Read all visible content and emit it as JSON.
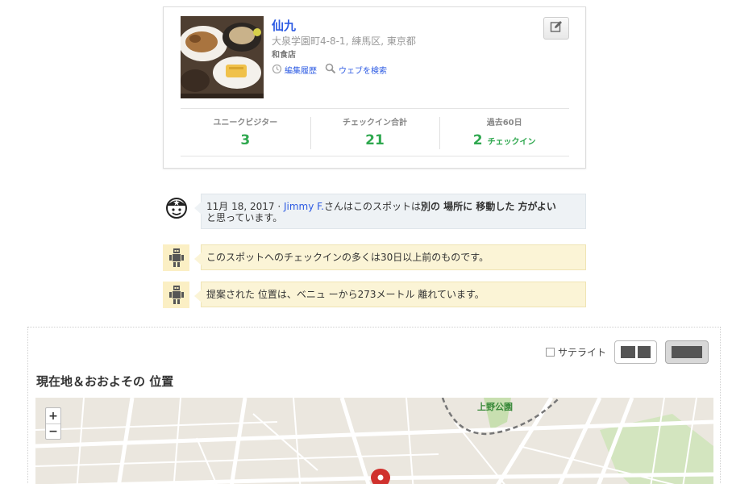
{
  "venue": {
    "name": "仙九",
    "address": "大泉学園町4-8-1, 練馬区, 東京都",
    "category": "和食店",
    "links": [
      {
        "label": "編集履歴",
        "icon": "history-icon"
      },
      {
        "label": "ウェブを検索",
        "icon": "search-icon"
      }
    ],
    "edit_icon": "edit-icon"
  },
  "stats": [
    {
      "label": "ユニークビジター",
      "value": "3",
      "suffix": ""
    },
    {
      "label": "チェックイン合計",
      "value": "21",
      "suffix": ""
    },
    {
      "label": "過去60日",
      "value": "2",
      "suffix": "チェックイン"
    }
  ],
  "flags": [
    {
      "date": "11月 18, 2017 ·",
      "user": "Jimmy F.",
      "text_pre": "さんはこのスポットは",
      "text_strong": "別の 場所に 移動した 方がよい",
      "text_post": "と思っています。"
    },
    {
      "text": "このスポットへのチェックインの多くは30日以上前のものです。"
    },
    {
      "text": "提案された 位置は、ベニュ ーから273メートル 離れています。"
    }
  ],
  "map": {
    "satellite_label": "サテライト",
    "title": "現在地＆おおよその 位置",
    "zoom_in": "+",
    "zoom_out": "−",
    "park_label": "上野公園"
  },
  "colors": {
    "link": "#2d5be3",
    "stat_green": "#2fa84f",
    "flag_blue": "#eef2f5",
    "flag_yellow": "#fbf4d6",
    "pin_red": "#d0312d"
  }
}
